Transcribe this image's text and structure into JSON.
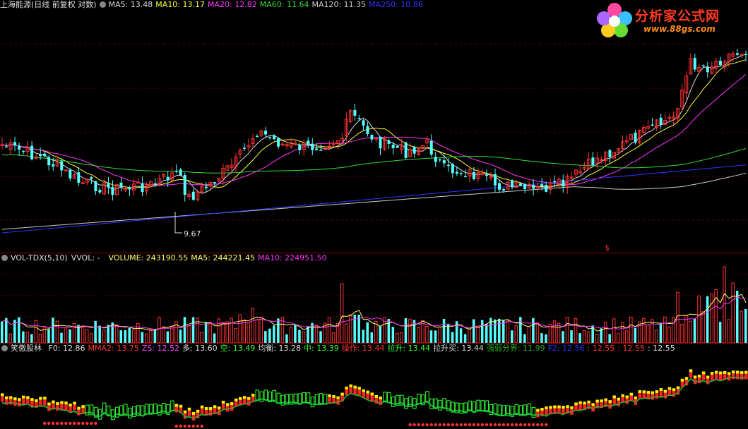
{
  "main": {
    "title": "上海能源(日线 前复权 对数)",
    "ma5": "MA5: 13.48",
    "ma10": "MA10: 13.17",
    "ma20": "MA20: 12.82",
    "ma60": "MA60: 11.64",
    "ma120": "MA120: 11.35",
    "ma250": "MA250: 10.86",
    "low_label": "9.67",
    "marker": "§"
  },
  "logo": {
    "name": "分析家公式网",
    "url": "www.88gs.com"
  },
  "volume": {
    "indicator": "VOL-TDX(5,10)",
    "vvol": "VVOL: -",
    "volume": "VOLUME: 243190.55",
    "ma5": "MA5: 244221.45",
    "ma10": "MA10: 224951.50"
  },
  "indicator": {
    "name": "笑傲股林",
    "items": [
      {
        "text": "F0: 12.86",
        "color": "#dddddd"
      },
      {
        "text": "MMA2: 13.75",
        "color": "#ff3333"
      },
      {
        "text": "ZS: 12.52",
        "color": "#ff44ff"
      },
      {
        "text": "多: 13.60",
        "color": "#dddddd"
      },
      {
        "text": "空: 13.49",
        "color": "#33ff33"
      },
      {
        "text": "均衡: 13.28",
        "color": "#dddddd"
      },
      {
        "text": "中: 13.39",
        "color": "#33ff33"
      },
      {
        "text": "操作: 13.44",
        "color": "#ff3333"
      },
      {
        "text": "拉升: 13.44",
        "color": "#33ff33"
      },
      {
        "text": "拉升买: 13.44",
        "color": "#dddddd"
      },
      {
        "text": "强弱分界: 11.99",
        "color": "#22aa22"
      },
      {
        "text": "F2: 12.56",
        "color": "#2233ff"
      },
      {
        "text": ": 12.55",
        "color": "#ff3333"
      },
      {
        "text": ": 12.55",
        "color": "#ff3333"
      },
      {
        "text": ": 12.55",
        "color": "#dddddd"
      }
    ]
  },
  "colors": {
    "ma5": "#dddddd",
    "ma10": "#ffff33",
    "ma20": "#ff33ff",
    "ma60": "#33dd33",
    "ma120": "#cccccc",
    "ma250": "#3333ff",
    "up": "#ff3333",
    "down": "#55ffff"
  }
}
